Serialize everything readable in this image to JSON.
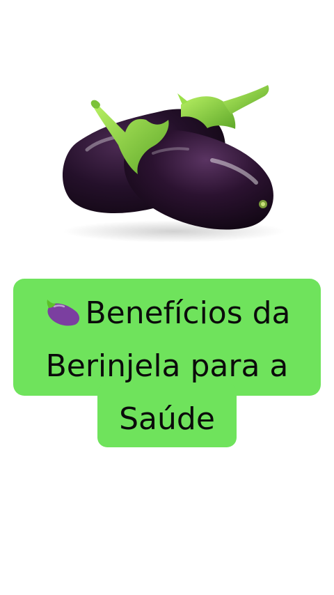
{
  "caption": {
    "line1": "Benefícios da",
    "line2": "Berinjela para a",
    "line3": "Saúde",
    "icon": "eggplant-icon"
  },
  "colors": {
    "caption_background": "#6fe35c",
    "eggplant_skin": "#2a1030",
    "stem": "#8fdc3a",
    "page_background": "#ffffff"
  }
}
